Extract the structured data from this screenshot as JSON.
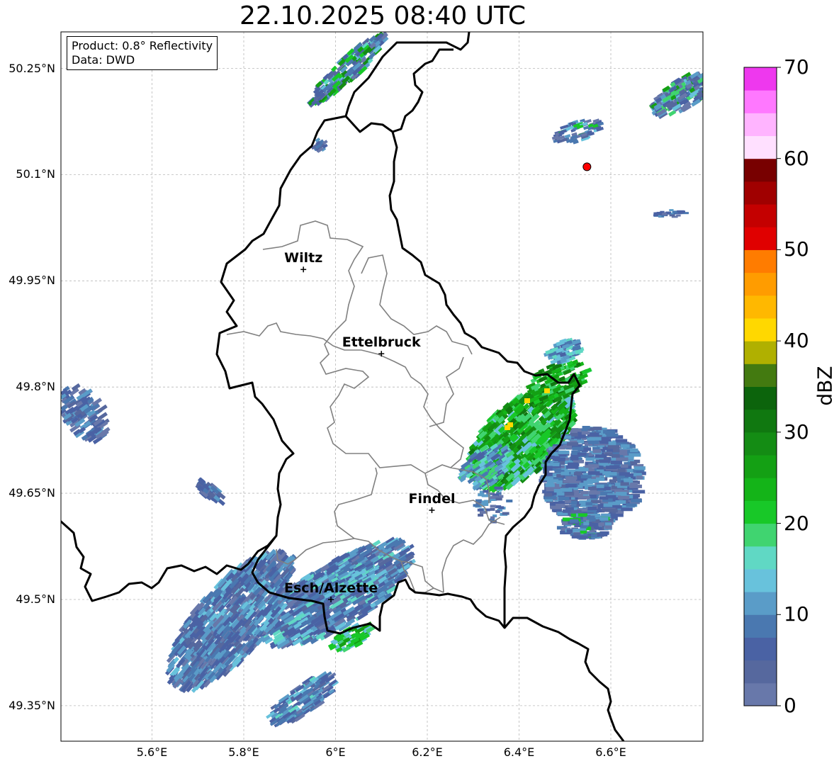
{
  "title": "22.10.2025 08:40 UTC",
  "info": {
    "line1": "Product: 0.8° Reflectivity",
    "line2": "Data: DWD"
  },
  "lat_ticks": [
    {
      "label": "50.25°N",
      "lat": 50.25
    },
    {
      "label": "50.1°N",
      "lat": 50.1
    },
    {
      "label": "49.95°N",
      "lat": 49.95
    },
    {
      "label": "49.8°N",
      "lat": 49.8
    },
    {
      "label": "49.65°N",
      "lat": 49.65
    },
    {
      "label": "49.5°N",
      "lat": 49.5
    },
    {
      "label": "49.35°N",
      "lat": 49.35
    }
  ],
  "lon_ticks": [
    {
      "label": "5.6°E",
      "lon": 5.6
    },
    {
      "label": "5.8°E",
      "lon": 5.8
    },
    {
      "label": "6°E",
      "lon": 6.0
    },
    {
      "label": "6.2°E",
      "lon": 6.2
    },
    {
      "label": "6.4°E",
      "lon": 6.4
    },
    {
      "label": "6.6°E",
      "lon": 6.6
    }
  ],
  "cities": [
    {
      "name": "Wiltz",
      "lon": 5.93,
      "lat": 49.966
    },
    {
      "name": "Ettelbruck",
      "lon": 6.1,
      "lat": 49.847
    },
    {
      "name": "Findel",
      "lon": 6.21,
      "lat": 49.626
    },
    {
      "name": "Esch/Alzette",
      "lon": 5.99,
      "lat": 49.5
    }
  ],
  "radar_site": {
    "lon": 6.548,
    "lat": 50.111,
    "color": "#ff0000"
  },
  "colorbar": {
    "label": "dBZ",
    "ticks": [
      "0",
      "10",
      "20",
      "30",
      "40",
      "50",
      "60",
      "70"
    ],
    "colors": [
      "#6878aa",
      "#56689e",
      "#4a62a4",
      "#4a78b0",
      "#5a9cc8",
      "#68c2dc",
      "#60d8c4",
      "#40d470",
      "#18c828",
      "#14b418",
      "#14a014",
      "#148c14",
      "#107810",
      "#0c640c",
      "#437a10",
      "#b0b000",
      "#ffd800",
      "#ffb800",
      "#ff9c00",
      "#ff7c00",
      "#e00000",
      "#c40000",
      "#a00000",
      "#780000",
      "#ffe0ff",
      "#ffb4ff",
      "#ff78ff",
      "#ee38ee"
    ]
  }
}
